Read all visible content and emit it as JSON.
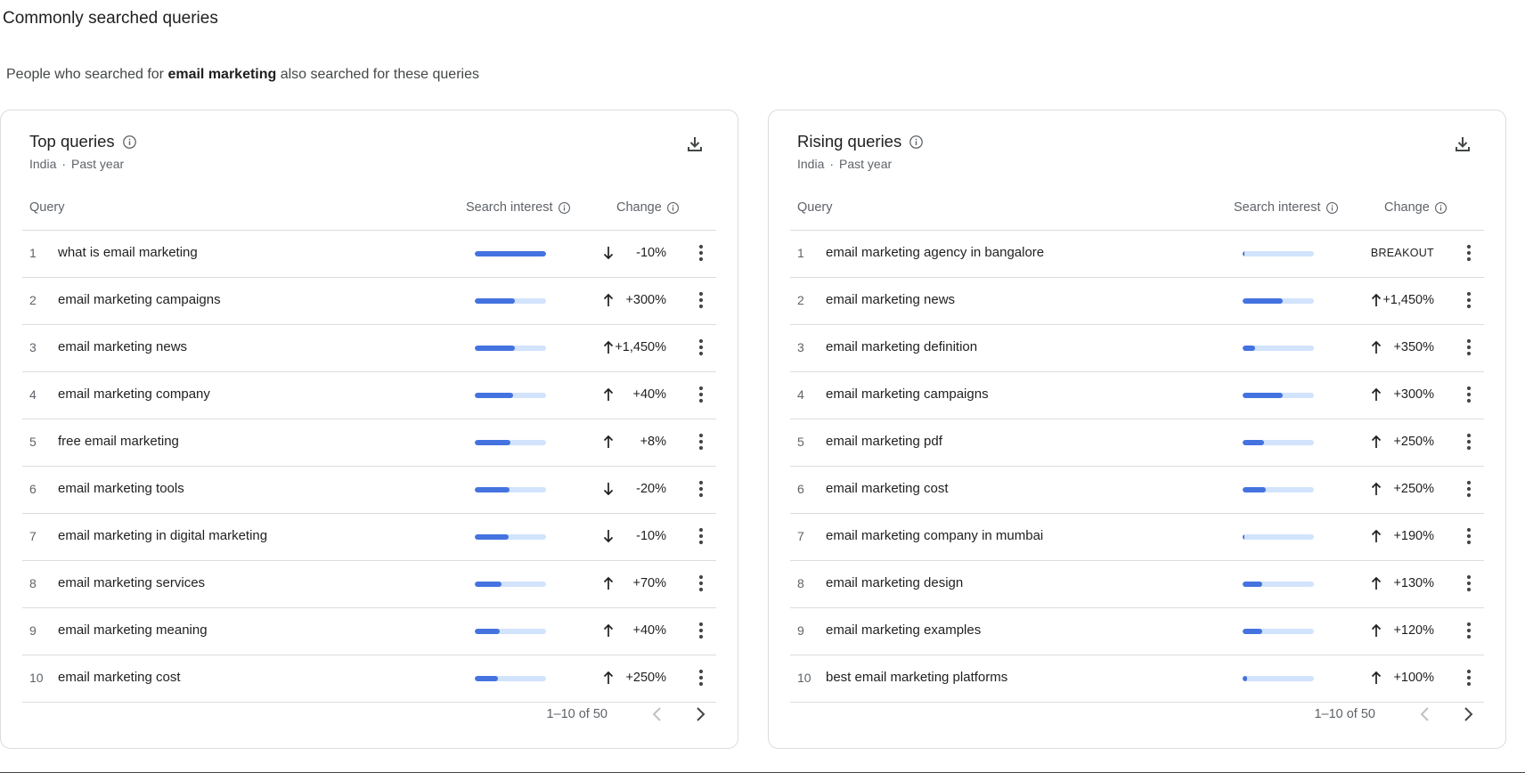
{
  "page": {
    "title": "Commonly searched queries",
    "subtitle_prefix": "People who searched for ",
    "subtitle_term": "email marketing",
    "subtitle_suffix": " also searched for these queries"
  },
  "colors": {
    "bar_fill": "#4473e0",
    "bar_track": "#d2e3fc",
    "border": "#dadce0",
    "muted": "#5f6368"
  },
  "cards": [
    {
      "title": "Top queries",
      "location": "India",
      "period": "Past year",
      "columns": {
        "query": "Query",
        "interest": "Search interest",
        "change": "Change"
      },
      "pagination": "1–10 of 50",
      "rows": [
        {
          "rank": "1",
          "query": "what is email marketing",
          "interest": 100,
          "direction": "down",
          "change": "-10%"
        },
        {
          "rank": "2",
          "query": "email marketing campaigns",
          "interest": 56,
          "direction": "up",
          "change": "+300%"
        },
        {
          "rank": "3",
          "query": "email marketing news",
          "interest": 56,
          "direction": "up",
          "change": "+1,450%"
        },
        {
          "rank": "4",
          "query": "email marketing company",
          "interest": 54,
          "direction": "up",
          "change": "+40%"
        },
        {
          "rank": "5",
          "query": "free email marketing",
          "interest": 50,
          "direction": "up",
          "change": "+8%"
        },
        {
          "rank": "6",
          "query": "email marketing tools",
          "interest": 49,
          "direction": "down",
          "change": "-20%"
        },
        {
          "rank": "7",
          "query": "email marketing in digital marketing",
          "interest": 48,
          "direction": "down",
          "change": "-10%"
        },
        {
          "rank": "8",
          "query": "email marketing services",
          "interest": 38,
          "direction": "up",
          "change": "+70%"
        },
        {
          "rank": "9",
          "query": "email marketing meaning",
          "interest": 35,
          "direction": "up",
          "change": "+40%"
        },
        {
          "rank": "10",
          "query": "email marketing cost",
          "interest": 32,
          "direction": "up",
          "change": "+250%"
        }
      ]
    },
    {
      "title": "Rising queries",
      "location": "India",
      "period": "Past year",
      "columns": {
        "query": "Query",
        "interest": "Search interest",
        "change": "Change"
      },
      "pagination": "1–10 of 50",
      "rows": [
        {
          "rank": "1",
          "query": "email marketing agency in bangalore",
          "interest": 3,
          "direction": "none",
          "change": "BREAKOUT"
        },
        {
          "rank": "2",
          "query": "email marketing news",
          "interest": 56,
          "direction": "up",
          "change": "+1,450%"
        },
        {
          "rank": "3",
          "query": "email marketing definition",
          "interest": 18,
          "direction": "up",
          "change": "+350%"
        },
        {
          "rank": "4",
          "query": "email marketing campaigns",
          "interest": 56,
          "direction": "up",
          "change": "+300%"
        },
        {
          "rank": "5",
          "query": "email marketing pdf",
          "interest": 30,
          "direction": "up",
          "change": "+250%"
        },
        {
          "rank": "6",
          "query": "email marketing cost",
          "interest": 32,
          "direction": "up",
          "change": "+250%"
        },
        {
          "rank": "7",
          "query": "email marketing company in mumbai",
          "interest": 3,
          "direction": "up",
          "change": "+190%"
        },
        {
          "rank": "8",
          "query": "email marketing design",
          "interest": 27,
          "direction": "up",
          "change": "+130%"
        },
        {
          "rank": "9",
          "query": "email marketing examples",
          "interest": 27,
          "direction": "up",
          "change": "+120%"
        },
        {
          "rank": "10",
          "query": "best email marketing platforms",
          "interest": 6,
          "direction": "up",
          "change": "+100%"
        }
      ]
    }
  ]
}
